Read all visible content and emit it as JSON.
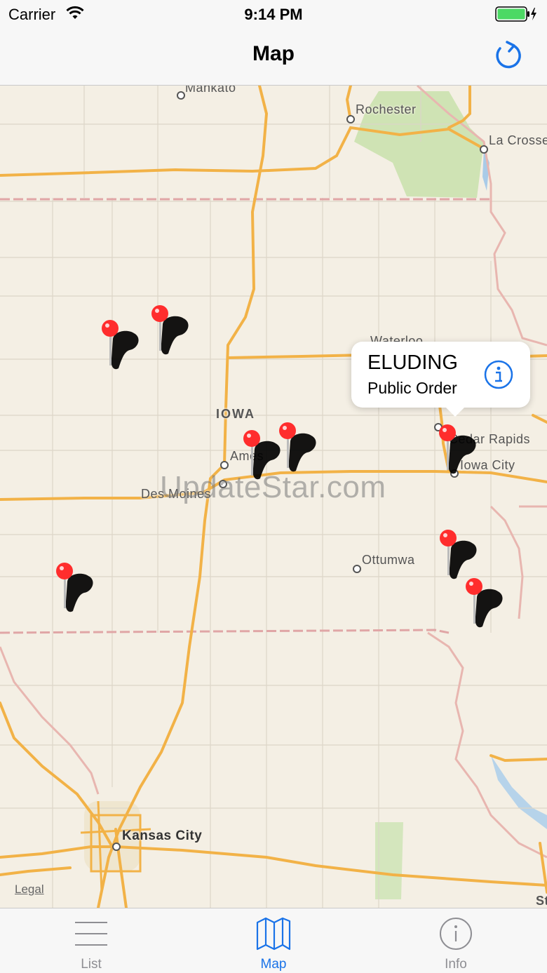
{
  "status_bar": {
    "carrier": "Carrier",
    "time": "9:14 PM",
    "battery_color": "#4cd964"
  },
  "nav": {
    "title": "Map",
    "refresh_icon": "refresh-icon",
    "accent_color": "#1a73e8"
  },
  "map": {
    "labels": {
      "mankato": "Mankato",
      "rochester": "Rochester",
      "la_crosse": "La Crosse",
      "waterloo": "Waterloo",
      "iowa": "IOWA",
      "ames": "Ames",
      "des_moines": "Des Moines",
      "cedar_rapids": "Cedar Rapids",
      "iowa_city": "Iowa City",
      "ottumwa": "Ottumwa",
      "kansas_city": "Kansas City",
      "edge_st": "St"
    },
    "watermark": "UpdateStar.com",
    "legal": "Legal",
    "pin_color": "#ff2d2d",
    "callout": {
      "title": "ELUDING",
      "subtitle": "Public Order",
      "icon": "info-icon"
    }
  },
  "tab_bar": {
    "tabs": [
      {
        "label": "List",
        "icon": "list-icon",
        "active": false
      },
      {
        "label": "Map",
        "icon": "map-icon",
        "active": true
      },
      {
        "label": "Info",
        "icon": "info-icon",
        "active": false
      }
    ]
  }
}
